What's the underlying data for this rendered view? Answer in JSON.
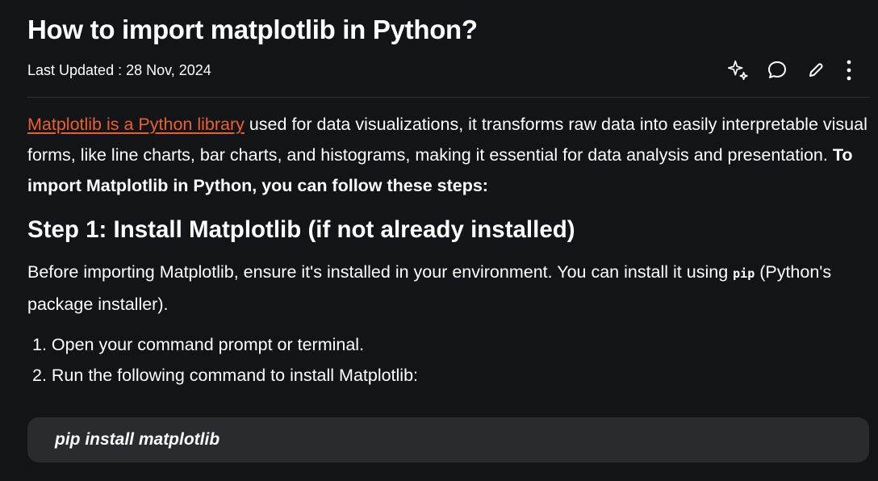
{
  "article": {
    "title": "How to import matplotlib in Python?",
    "last_updated": "Last Updated : 28 Nov, 2024"
  },
  "toolbar": {
    "icons": [
      "sparkle-icon",
      "comment-icon",
      "edit-icon",
      "more-icon"
    ]
  },
  "intro": {
    "link_text": "Matplotlib is a Python library",
    "text": " used for data visualizations, it transforms raw data into easily interpretable visual forms, like line charts, bar charts, and histograms, making it essential for data analysis and presentation. ",
    "bold_text": "To import Matplotlib in Python, you can follow these steps:"
  },
  "step1": {
    "heading": "Step 1: Install Matplotlib (if not already installed)",
    "para_before": "Before importing Matplotlib, ensure it's installed in your environment. You can install it using ",
    "code": "pip",
    "para_after": " (Python's package installer).",
    "list": [
      "1. Open your command prompt or terminal.",
      "2. Run the following command to install Matplotlib:"
    ],
    "command": "pip install matplotlib"
  },
  "colors": {
    "background": "#131417",
    "link": "#e8612c",
    "code_block": "#2a2b2f"
  }
}
